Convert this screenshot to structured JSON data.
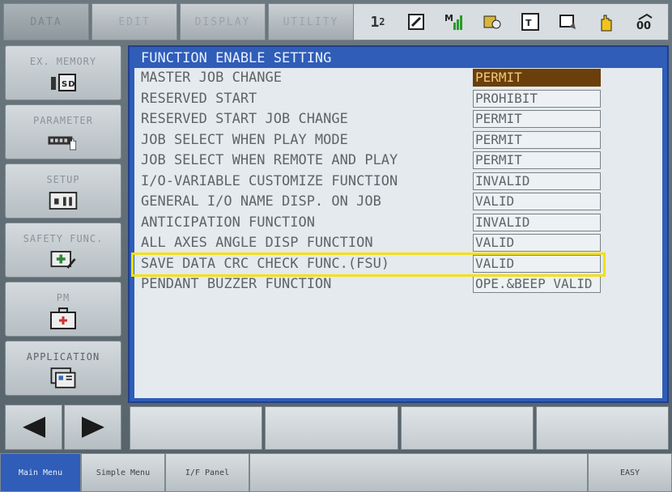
{
  "top_menu": {
    "tabs": [
      "DATA",
      "EDIT",
      "DISPLAY",
      "UTILITY"
    ]
  },
  "status": {
    "icons": [
      "job-number-icon",
      "edit-mode-icon",
      "manual-speed-icon",
      "security-icon",
      "teach-mode-icon",
      "cycle-icon",
      "hand-stop-icon",
      "coordinate-icon"
    ],
    "speed_text": "1",
    "cycle_text": "2"
  },
  "side_menu": {
    "items": [
      {
        "label": "EX. MEMORY",
        "icon": "sd-card-icon"
      },
      {
        "label": "PARAMETER",
        "icon": "parameter-hand-icon"
      },
      {
        "label": "SETUP",
        "icon": "setup-icon"
      },
      {
        "label": "SAFETY FUNC.",
        "icon": "safety-plus-icon"
      },
      {
        "label": "PM",
        "icon": "medical-kit-icon"
      },
      {
        "label": "APPLICATION",
        "icon": "application-icon"
      }
    ]
  },
  "window": {
    "title": "FUNCTION ENABLE SETTING"
  },
  "settings": [
    {
      "label": "MASTER JOB CHANGE",
      "value": "PERMIT"
    },
    {
      "label": "RESERVED START",
      "value": "PROHIBIT"
    },
    {
      "label": "RESERVED START JOB CHANGE",
      "value": "PERMIT"
    },
    {
      "label": "JOB SELECT WHEN PLAY MODE",
      "value": "PERMIT"
    },
    {
      "label": "JOB SELECT WHEN REMOTE AND PLAY",
      "value": "PERMIT"
    },
    {
      "label": "I/O-VARIABLE CUSTOMIZE FUNCTION",
      "value": "INVALID"
    },
    {
      "label": "GENERAL I/O NAME DISP. ON JOB",
      "value": "VALID"
    },
    {
      "label": "ANTICIPATION FUNCTION",
      "value": "INVALID"
    },
    {
      "label": "ALL AXES ANGLE DISP FUNCTION",
      "value": "VALID"
    },
    {
      "label": "SAVE DATA CRC CHECK FUNC.(FSU)",
      "value": "VALID"
    },
    {
      "label": "PENDANT BUZZER FUNCTION",
      "value": "OPE.&BEEP VALID"
    }
  ],
  "bottom_tabs": [
    "Main Menu",
    "Simple Menu",
    "I/F Panel",
    "EASY"
  ],
  "colors": {
    "window_bg": "#2f5db8",
    "selected_value_bg": "#6b3f0b",
    "highlight": "#f5df16"
  }
}
